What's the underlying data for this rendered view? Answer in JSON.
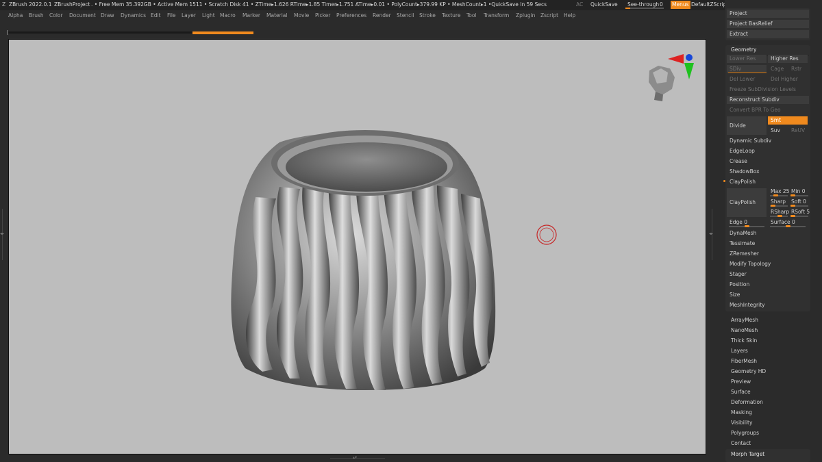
{
  "titlebar": {
    "app": "ZBrush 2022.0.1",
    "project": "ZBrushProject",
    "status": ". • Free Mem 35.392GB • Active Mem 1511 • Scratch Disk 41 • ZTime▸1.626 RTime▸1.85 Timer▸1.751 ATime▸0.01 • PolyCount▸379.99 KP • MeshCount▸1 •QuickSave In 59 Secs",
    "ac": "AC",
    "quicksave": "QuickSave",
    "seethrough_label": "See-through",
    "seethrough_value": "0",
    "menus": "Menus",
    "defaultzscript": "DefaultZScript"
  },
  "menubar": {
    "items": [
      "Alpha",
      "Brush",
      "Color",
      "Document",
      "Draw",
      "Dynamics",
      "Edit",
      "File",
      "Layer",
      "Light",
      "Macro",
      "Marker",
      "Material",
      "Movie",
      "Picker",
      "Preferences",
      "Render",
      "Stencil",
      "Stroke",
      "Texture",
      "Tool",
      "Transform",
      "Zplugin",
      "Zscript",
      "Help"
    ]
  },
  "rightpanel": {
    "top": [
      "Project",
      "Project BasRelief",
      "Extract"
    ],
    "geometry_title": "Geometry",
    "lower_res": "Lower Res",
    "higher_res": "Higher Res",
    "sdiv": "SDiv",
    "cage": "Cage",
    "rstr": "Rstr",
    "del_lower": "Del Lower",
    "del_higher": "Del Higher",
    "freeze": "Freeze SubDivision Levels",
    "reconstruct": "Reconstruct Subdiv",
    "convert_bpr": "Convert BPR To Geo",
    "divide": "Divide",
    "smt": "Smt",
    "suv": "Suv",
    "reuv": "ReUV",
    "dynamic_subdiv": "Dynamic Subdiv",
    "edgeloop": "EdgeLoop",
    "crease": "Crease",
    "shadowbox": "ShadowBox",
    "claypolish_header": "ClayPolish",
    "claypolish": "ClayPolish",
    "max": "Max 25",
    "min": "Min 0",
    "sharp": "Sharp",
    "soft": "Soft 0",
    "rsharp": "RSharp",
    "rsoft": "RSoft 5",
    "edge": "Edge 0",
    "surface": "Surface 0",
    "geo_items": [
      "DynaMesh",
      "Tessimate",
      "ZRemesher",
      "Modify Topology",
      "Stager",
      "Position",
      "Size",
      "MeshIntegrity"
    ],
    "sub_items": [
      "ArrayMesh",
      "NanoMesh",
      "Thick Skin",
      "Layers",
      "FiberMesh",
      "Geometry HD",
      "Preview",
      "Surface",
      "Deformation",
      "Masking",
      "Visibility",
      "Polygroups",
      "Contact"
    ],
    "morph_target": "Morph Target"
  },
  "colors": {
    "accent": "#f08a1e",
    "viewport_bg": "#bdbdbd",
    "panel_bg": "#2b2b2b"
  }
}
